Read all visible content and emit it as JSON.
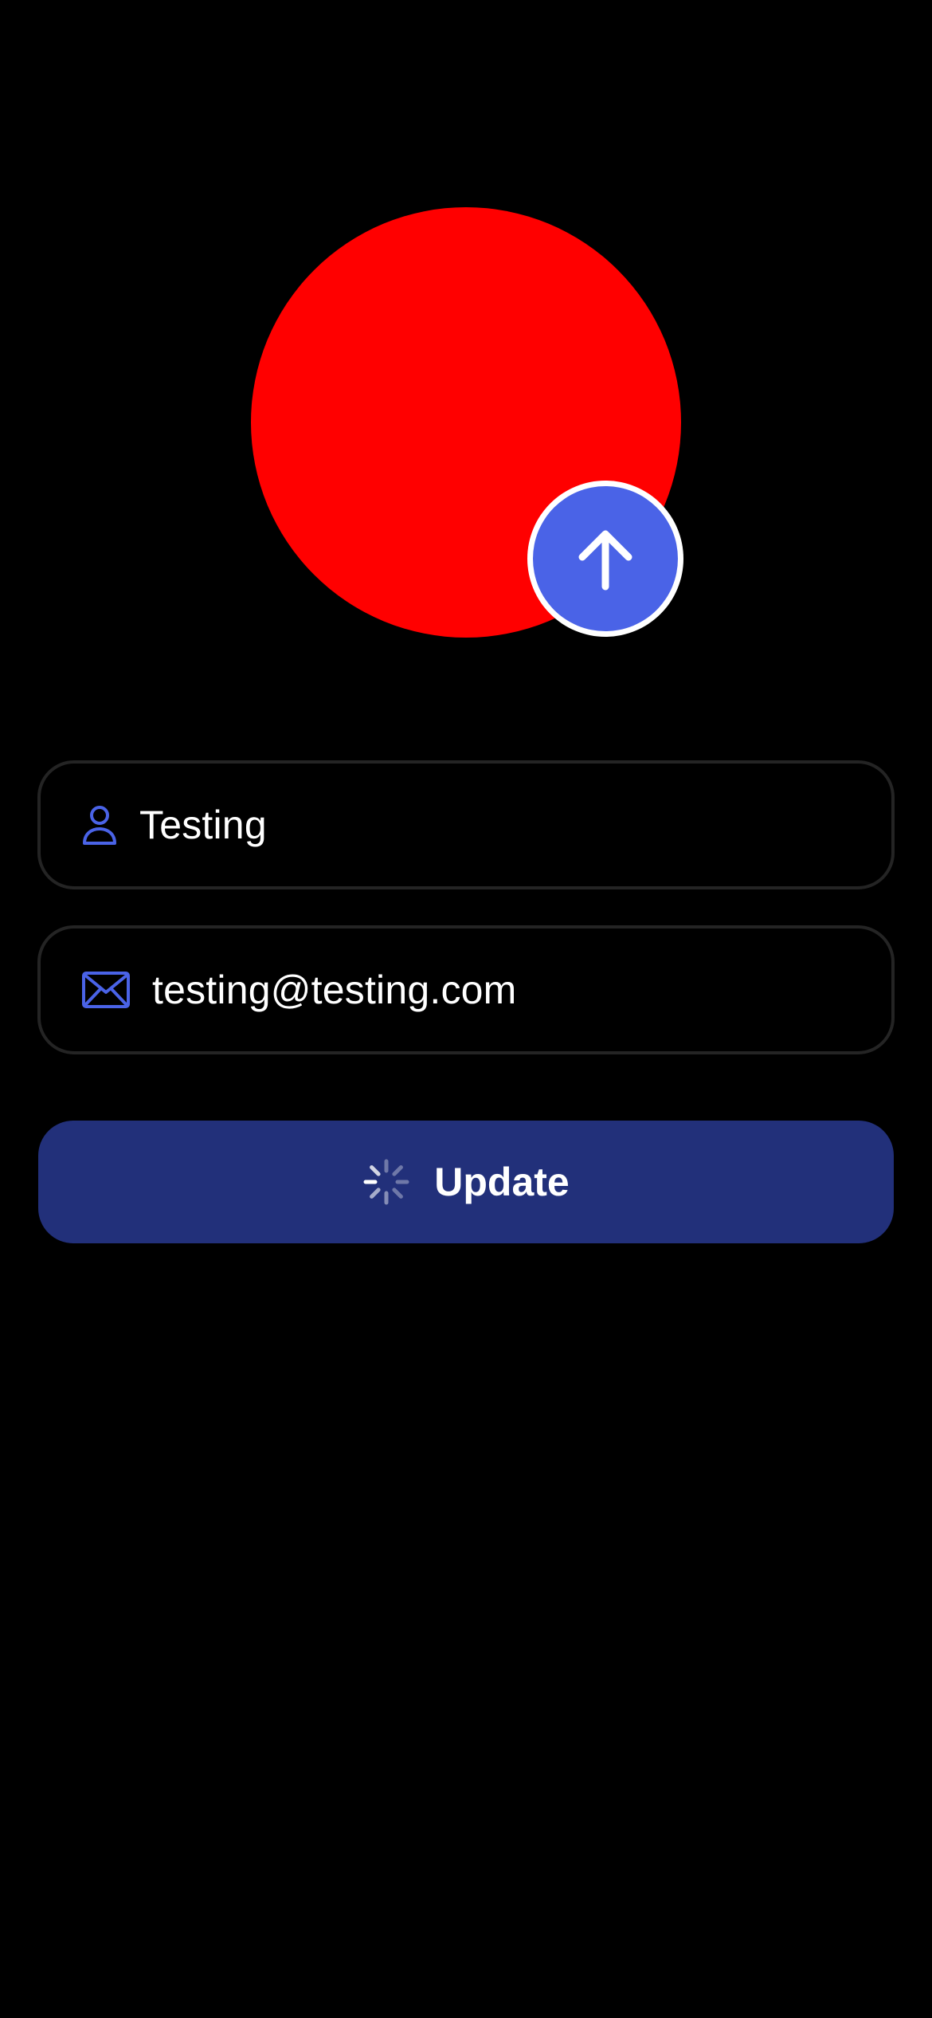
{
  "profile": {
    "avatar_color": "#ff0000",
    "upload_button": {
      "icon": "arrow-up-icon",
      "color": "#4a63e7"
    }
  },
  "form": {
    "name_field": {
      "icon": "person-icon",
      "value": "Testing"
    },
    "email_field": {
      "icon": "envelope-icon",
      "value": "testing@testing.com"
    }
  },
  "update_button": {
    "label": "Update",
    "loading": true,
    "color": "#22307a"
  },
  "accent_color": "#4a63e7"
}
